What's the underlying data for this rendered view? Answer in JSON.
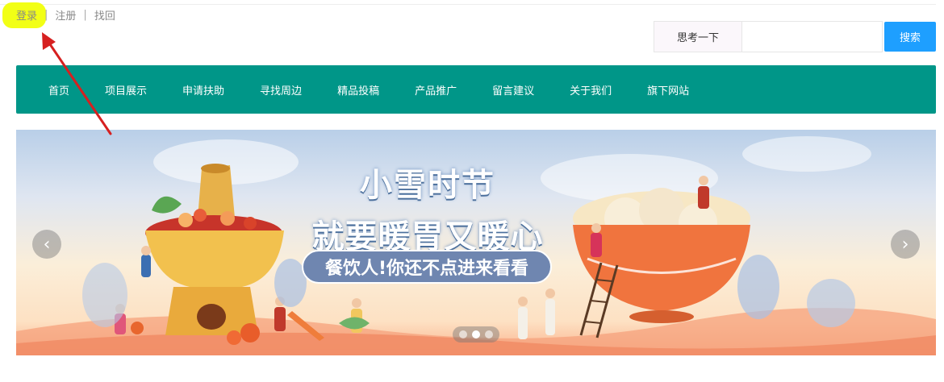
{
  "account": {
    "login": "登录",
    "register": "注册",
    "recover": "找回",
    "separator": "|"
  },
  "search": {
    "label": "思考一下",
    "input_value": "",
    "placeholder": "",
    "button": "搜索"
  },
  "nav": {
    "items": [
      {
        "label": "首页"
      },
      {
        "label": "项目展示"
      },
      {
        "label": "申请扶助"
      },
      {
        "label": "寻找周边"
      },
      {
        "label": "精品投稿"
      },
      {
        "label": "产品推广"
      },
      {
        "label": "留言建议"
      },
      {
        "label": "关于我们"
      },
      {
        "label": "旗下网站"
      }
    ]
  },
  "banner": {
    "headline_line1": "小雪时节",
    "headline_line2": "就要暖胃又暖心",
    "subline": "餐饮人!你还不点进来看看",
    "prev_icon": "chevron-left-icon",
    "next_icon": "chevron-right-icon",
    "prev_glyph": "‹",
    "next_glyph": "›",
    "slide_count": 3,
    "active_slide": 2
  },
  "colors": {
    "nav_bg": "#009688",
    "search_button": "#1e9fff",
    "highlight": "#f2ff16",
    "annotation_arrow": "#d62020"
  }
}
